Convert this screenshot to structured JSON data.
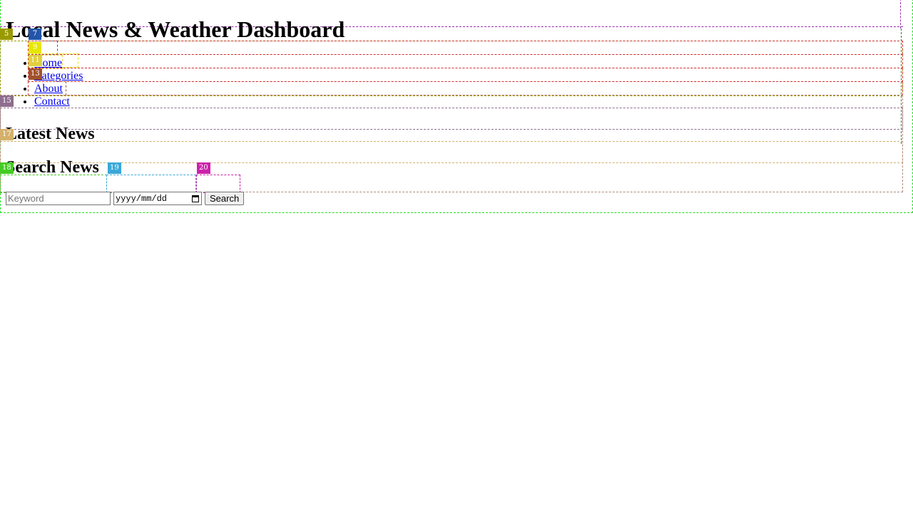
{
  "header": {
    "title": "Local News & Weather Dashboard"
  },
  "nav": {
    "items": [
      {
        "label": "Home"
      },
      {
        "label": "Categories"
      },
      {
        "label": "About"
      },
      {
        "label": "Contact"
      }
    ]
  },
  "latest_news": {
    "heading": "Latest News"
  },
  "search": {
    "heading": "Search News",
    "keyword_placeholder": "Keyword",
    "date_placeholder": "yyyy/mm/dd",
    "button_label": "Search"
  },
  "overlay_labels": {
    "b5": "5",
    "b7": "7",
    "b9": "9",
    "b11": "11",
    "b13": "13",
    "b15": "15",
    "b17": "17",
    "b18": "18",
    "b19": "19",
    "b20": "20"
  },
  "overlay_colors": {
    "c_outer_right": "#9c27b0",
    "c_green_right": "#2e7d32",
    "c_body": "#22dd22",
    "c5": "#9a9a00",
    "c7": "#2255aa",
    "c9": "#e6e600",
    "c11": "#e0d040",
    "c13": "#a0522d",
    "c_nav_rows": "#cc3333",
    "c15": "#8e6e8e",
    "c17": "#d4b06a",
    "c_section": "#b08a7a",
    "c18": "#44cc22",
    "c19": "#3aa8d8",
    "c20": "#cc22aa"
  }
}
